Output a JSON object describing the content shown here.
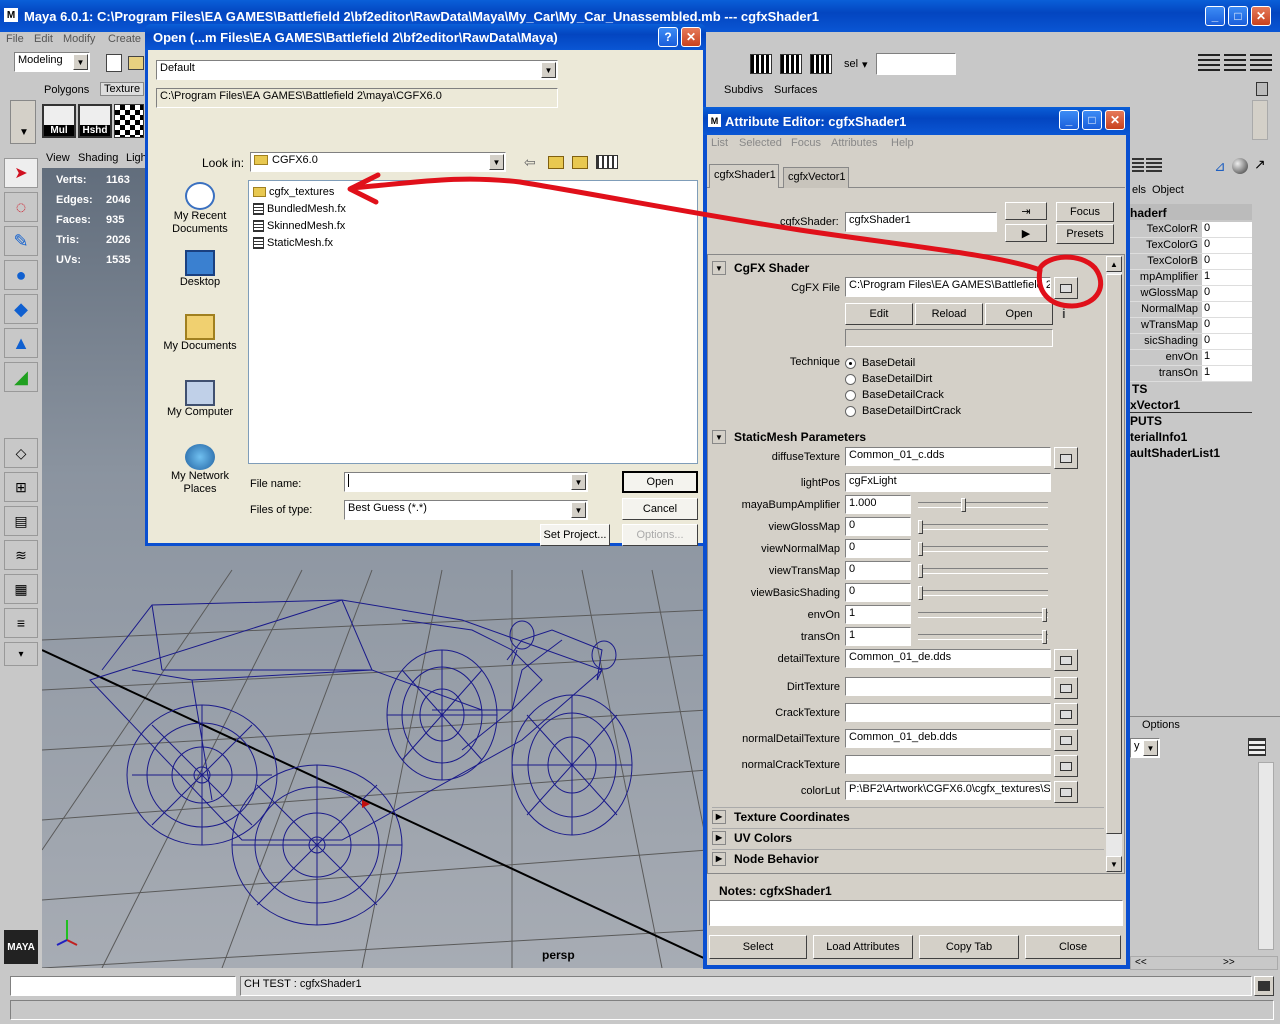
{
  "maya": {
    "title": "Maya 6.0.1: C:\\Program Files\\EA GAMES\\Battlefield 2\\bf2editor\\RawData\\Maya\\My_Car\\My_Car_Unassembled.mb   ---   cgfxShader1",
    "menu": [
      "File",
      "Edit",
      "Modify",
      "Create"
    ],
    "mode": "Modeling",
    "shelf_tabs": [
      "Polygons",
      "Texture"
    ],
    "shelf_tabs_right": [
      "Subdivs",
      "Surfaces"
    ],
    "sel_label": "sel",
    "shelf_icons": [
      "Mul",
      "Hshd"
    ],
    "panel_menu": [
      "View",
      "Shading",
      "Ligh"
    ],
    "stats": [
      {
        "label": "Verts:",
        "value": "1163"
      },
      {
        "label": "Edges:",
        "value": "2046"
      },
      {
        "label": "Faces:",
        "value": "935"
      },
      {
        "label": "Tris:",
        "value": "2026"
      },
      {
        "label": "UVs:",
        "value": "1535"
      }
    ],
    "camera": "persp",
    "logo_text": "MAYA",
    "command_feedback": "CH TEST : cgfxShader1"
  },
  "channel_box": {
    "tabs": [
      "els",
      "Object"
    ],
    "node": "haderf",
    "rows": [
      {
        "name": "TexColorR",
        "value": "0"
      },
      {
        "name": "TexColorG",
        "value": "0"
      },
      {
        "name": "TexColorB",
        "value": "0"
      },
      {
        "name": "mpAmplifier",
        "value": "1"
      },
      {
        "name": "wGlossMap",
        "value": "0"
      },
      {
        "name": "NormalMap",
        "value": "0"
      },
      {
        "name": "wTransMap",
        "value": "0"
      },
      {
        "name": "sicShading",
        "value": "0"
      },
      {
        "name": "envOn",
        "value": "1"
      },
      {
        "name": "transOn",
        "value": "1"
      }
    ],
    "section_a": "TS",
    "node2": "xVector1",
    "section_b": "PUTS",
    "outputs": [
      "terialInfo1",
      "aultShaderList1"
    ],
    "options": "Options",
    "layer_dd": "y",
    "scroll_left": "<<",
    "scroll_right": ">>"
  },
  "open_dialog": {
    "title": "Open (...m Files\\EA GAMES\\Battlefield 2\\bf2editor\\RawData\\Maya)",
    "bookmark": "Default",
    "path": "C:\\Program Files\\EA GAMES\\Battlefield 2\\maya\\CGFX6.0",
    "look_in_label": "Look in:",
    "look_in_value": "CGFX6.0",
    "places": [
      "My Recent Documents",
      "Desktop",
      "My Documents",
      "My Computer",
      "My Network Places"
    ],
    "files": [
      {
        "name": "cgfx_textures",
        "type": "folder"
      },
      {
        "name": "BundledMesh.fx",
        "type": "file"
      },
      {
        "name": "SkinnedMesh.fx",
        "type": "file"
      },
      {
        "name": "StaticMesh.fx",
        "type": "file"
      }
    ],
    "file_name_label": "File name:",
    "file_name_value": "",
    "file_type_label": "Files of type:",
    "file_type_value": "Best Guess (*.*)",
    "open_btn": "Open",
    "cancel_btn": "Cancel",
    "set_project_btn": "Set Project...",
    "options_btn": "Options..."
  },
  "attr_editor": {
    "title": "Attribute Editor: cgfxShader1",
    "menu": [
      "List",
      "Selected",
      "Focus",
      "Attributes",
      "Help"
    ],
    "tabs": [
      "cgfxShader1",
      "cgfxVector1"
    ],
    "node_label": "cgfxShader:",
    "node_value": "cgfxShader1",
    "focus_btn": "Focus",
    "presets_btn": "Presets",
    "cgfx_section": "CgFX Shader",
    "cgfx_file_label": "CgFX File",
    "cgfx_file_value": "C:\\Program Files\\EA GAMES\\Battlefield 2\\",
    "edit_btn": "Edit",
    "reload_btn": "Reload",
    "open_btn": "Open",
    "technique_label": "Technique",
    "techniques": [
      "BaseDetail",
      "BaseDetailDirt",
      "BaseDetailCrack",
      "BaseDetailDirtCrack"
    ],
    "selected_technique": 0,
    "params_section": "StaticMesh Parameters",
    "params": [
      {
        "label": "diffuseTexture",
        "value": "Common_01_c.dds",
        "kind": "file"
      },
      {
        "label": "lightPos",
        "value": "cgFxLight",
        "kind": "text"
      },
      {
        "label": "mayaBumpAmplifier",
        "value": "1.000",
        "kind": "slider",
        "level": 0.35
      },
      {
        "label": "viewGlossMap",
        "value": "0",
        "kind": "slider",
        "level": 0
      },
      {
        "label": "viewNormalMap",
        "value": "0",
        "kind": "slider",
        "level": 0
      },
      {
        "label": "viewTransMap",
        "value": "0",
        "kind": "slider",
        "level": 0
      },
      {
        "label": "viewBasicShading",
        "value": "0",
        "kind": "slider",
        "level": 0
      },
      {
        "label": "envOn",
        "value": "1",
        "kind": "slider",
        "level": 1
      },
      {
        "label": "transOn",
        "value": "1",
        "kind": "slider",
        "level": 1
      },
      {
        "label": "detailTexture",
        "value": "Common_01_de.dds",
        "kind": "file"
      },
      {
        "label": "DirtTexture",
        "value": "",
        "kind": "file"
      },
      {
        "label": "CrackTexture",
        "value": "",
        "kind": "file"
      },
      {
        "label": "normalDetailTexture",
        "value": "Common_01_deb.dds",
        "kind": "file"
      },
      {
        "label": "normalCrackTexture",
        "value": "",
        "kind": "file"
      },
      {
        "label": "colorLut",
        "value": "P:\\BF2\\Artwork\\CGFX6.0\\cgfx_textures\\S",
        "kind": "file"
      }
    ],
    "collapsed_sections": [
      "Texture Coordinates",
      "UV Colors",
      "Node Behavior"
    ],
    "notes_label": "Notes: cgfxShader1",
    "bottom_buttons": [
      "Select",
      "Load Attributes",
      "Copy Tab",
      "Close"
    ]
  },
  "colors": {
    "xp_title": "#0a4fd0",
    "annotation": "#e0101a",
    "wireframe": "#1a1a8a",
    "stats_text": "#ffffff"
  }
}
